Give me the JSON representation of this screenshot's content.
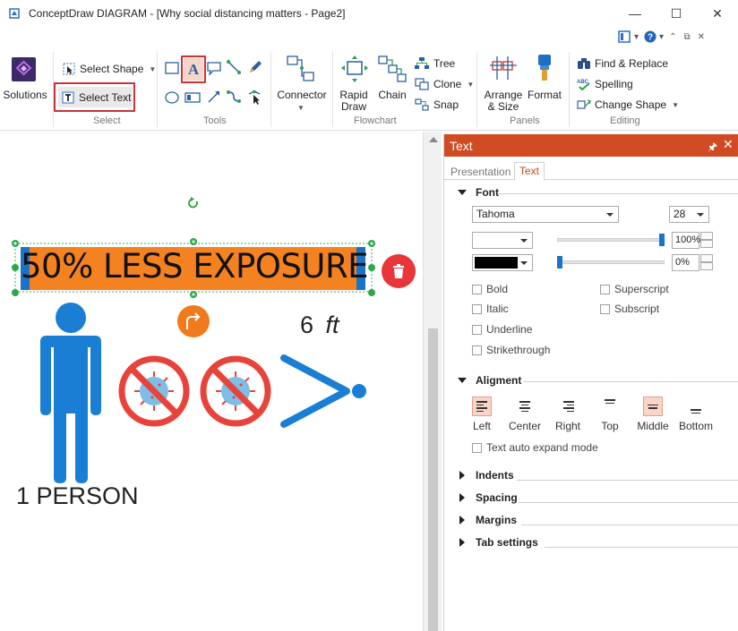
{
  "window": {
    "title": "ConceptDraw DIAGRAM - [Why social distancing matters - Page2]",
    "min": "—",
    "max": "☐",
    "close": "✕"
  },
  "ribbon": {
    "solutions": "Solutions",
    "select_shape": "Select Shape",
    "select_text": "Select Text",
    "group_select": "Select",
    "group_tools": "Tools",
    "connector": "Connector",
    "rapid_draw_1": "Rapid",
    "rapid_draw_2": "Draw",
    "chain": "Chain",
    "tree": "Tree",
    "clone": "Clone",
    "snap": "Snap",
    "group_flowchart": "Flowchart",
    "arrange_1": "Arrange",
    "arrange_2": "& Size",
    "format": "Format",
    "group_panels": "Panels",
    "find_replace": "Find & Replace",
    "spelling": "Spelling",
    "change_shape": "Change Shape",
    "group_editing": "Editing"
  },
  "canvas": {
    "banner_text": "50% LESS EXPOSURE",
    "distance_number": "6",
    "distance_unit": "ft",
    "person_label": "1 PERSON"
  },
  "panel": {
    "title": "Text",
    "pin": "🖈",
    "close": "✕",
    "tabs": [
      "Presentation",
      "Text"
    ],
    "font": {
      "section": "Font",
      "family": "Tahoma",
      "size": "28",
      "opacity1": "100%",
      "opacity2": "0%",
      "bold": "Bold",
      "italic": "Italic",
      "underline": "Underline",
      "strikethrough": "Strikethrough",
      "superscript": "Superscript",
      "subscript": "Subscript"
    },
    "alignment": {
      "section": "Aligment",
      "left": "Left",
      "center": "Center",
      "right": "Right",
      "top": "Top",
      "middle": "Middle",
      "bottom": "Bottom",
      "auto_expand": "Text auto expand mode"
    },
    "collapsed": [
      "Indents",
      "Spacing",
      "Margins",
      "Tab settings"
    ]
  },
  "colors": {
    "accent": "#d04a24",
    "banner_bg": "#f58221",
    "blue": "#1a7fd4",
    "virus_red": "#e8433b"
  }
}
